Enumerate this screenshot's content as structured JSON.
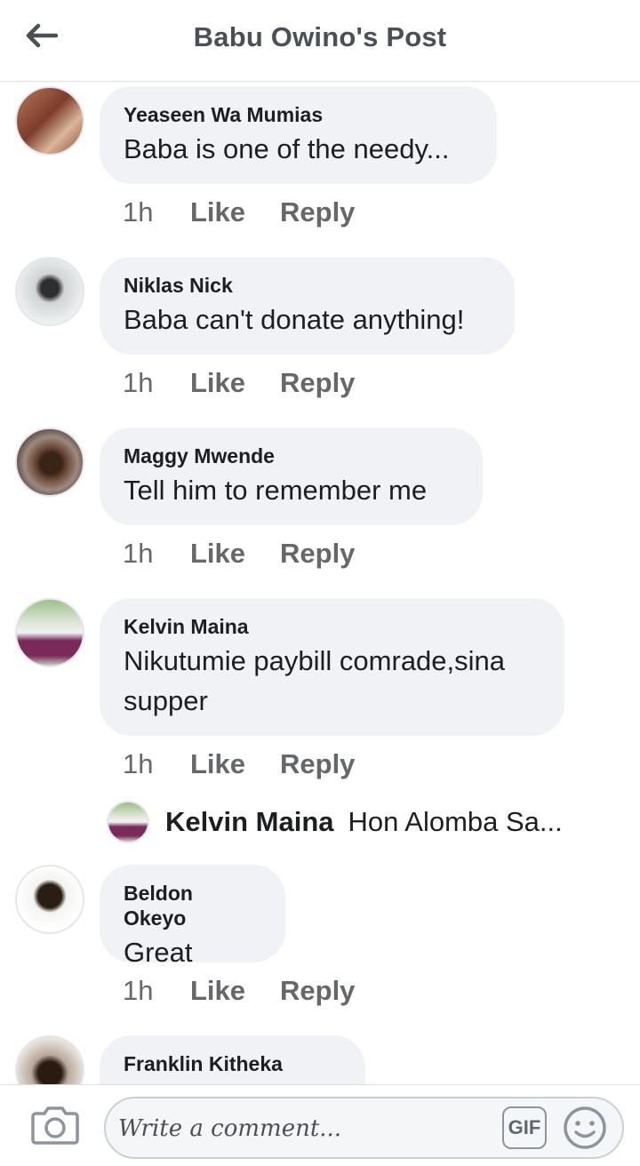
{
  "header": {
    "title": "Babu Owino's Post",
    "back_icon": "arrow-left-icon"
  },
  "comments": [
    {
      "author": "Yeaseen Wa Mumias",
      "text": "Baba is one of the needy...",
      "time": "1h",
      "like": "Like",
      "reply": "Reply"
    },
    {
      "author": "Niklas Nick",
      "text": "Baba can't donate anything!",
      "time": "1h",
      "like": "Like",
      "reply": "Reply"
    },
    {
      "author": "Maggy Mwende",
      "text": "Tell him to remember me",
      "time": "1h",
      "like": "Like",
      "reply": "Reply"
    },
    {
      "author": "Kelvin Maina",
      "text": "Nikutumie paybill comrade,sina supper",
      "time": "1h",
      "like": "Like",
      "reply": "Reply",
      "reply_preview": {
        "author": "Kelvin Maina",
        "text": "Hon Alomba Sa..."
      }
    },
    {
      "author": "Beldon Okeyo",
      "text": "Great",
      "time": "1h",
      "like": "Like",
      "reply": "Reply"
    },
    {
      "author": "Franklin Kitheka"
    }
  ],
  "composer": {
    "placeholder": "Write a comment...",
    "gif_label": "GIF",
    "camera_icon": "camera-icon",
    "emoji_icon": "emoji-smile-icon"
  },
  "colors": {
    "bubble": "#f0f2f5",
    "muted": "#65676b",
    "title": "#4b4f56"
  }
}
